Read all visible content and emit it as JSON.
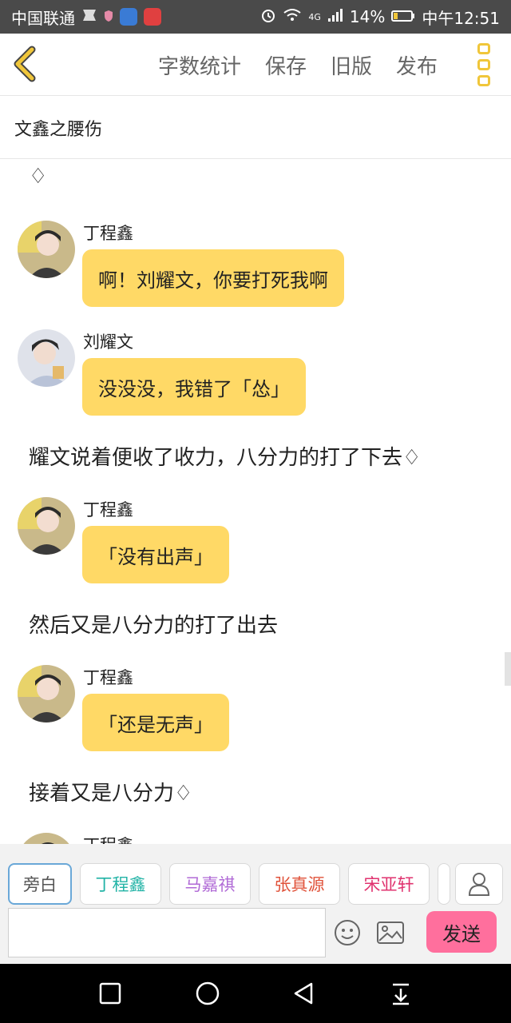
{
  "status_bar": {
    "carrier": "中国联通",
    "network": "4G",
    "battery": "14%",
    "time": "中午12:51"
  },
  "toolbar": {
    "word_count": "字数统计",
    "save": "保存",
    "old_version": "旧版",
    "publish": "发布"
  },
  "title": "文鑫之腰伤",
  "content": {
    "top_symbol": "♢",
    "messages": [
      {
        "speaker": "丁程鑫",
        "text": "啊！刘耀文，你要打死我啊"
      },
      {
        "speaker": "刘耀文",
        "text": "没没没，我错了「怂」"
      },
      {
        "speaker": "丁程鑫",
        "text": "「没有出声」"
      },
      {
        "speaker": "丁程鑫",
        "text": "「还是无声」"
      },
      {
        "speaker": "丁程鑫",
        "text": ""
      }
    ],
    "narrations": [
      "耀文说着便收了收力，八分力的打了下去♢",
      "然后又是八分力的打了出去",
      "接着又是八分力♢"
    ]
  },
  "character_chips": [
    {
      "label": "旁白",
      "color": "#555555"
    },
    {
      "label": "丁程鑫",
      "color": "#22b3a6"
    },
    {
      "label": "马嘉祺",
      "color": "#b06ad6"
    },
    {
      "label": "张真源",
      "color": "#e0523a"
    },
    {
      "label": "宋亚轩",
      "color": "#e0336f"
    }
  ],
  "input": {
    "value": "",
    "placeholder": ""
  },
  "send_label": "发送",
  "colors": {
    "accent_yellow": "#ffd966",
    "send_pink": "#ff6f9d"
  }
}
